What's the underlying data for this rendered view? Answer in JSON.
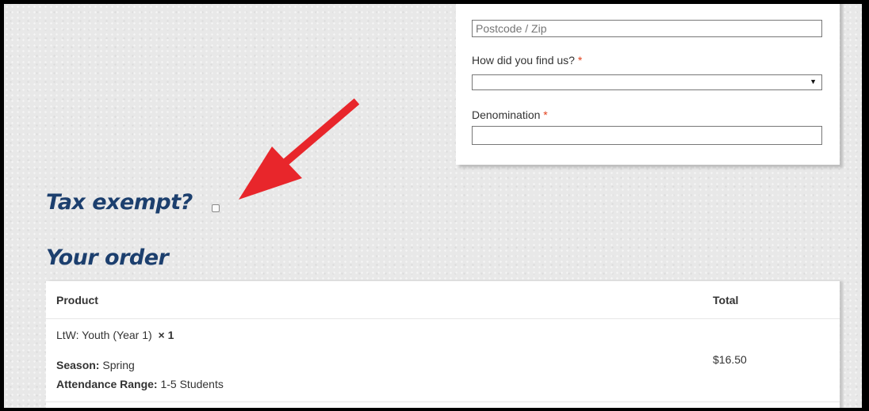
{
  "address_form": {
    "postcode_placeholder": "Postcode / Zip",
    "find_us_label": "How did you find us?",
    "find_us_required": "*",
    "find_us_value": "",
    "denomination_label": "Denomination",
    "denomination_required": "*",
    "denomination_value": ""
  },
  "tax": {
    "heading": "Tax exempt?",
    "checked": false
  },
  "order": {
    "heading": "Your order",
    "columns": {
      "product": "Product",
      "total": "Total"
    },
    "items": [
      {
        "name": "LtW: Youth (Year 1)",
        "quantity": "× 1",
        "season_label": "Season:",
        "season_value": "Spring",
        "attendance_label": "Attendance Range:",
        "attendance_value": "1-5 Students",
        "total": "$16.50"
      }
    ]
  },
  "colors": {
    "heading": "#1c3f6e",
    "required": "#e2401c",
    "arrow": "#e8262b"
  },
  "icons": {
    "annotation": "red-arrow-icon",
    "select": "dropdown-arrow-icon"
  }
}
